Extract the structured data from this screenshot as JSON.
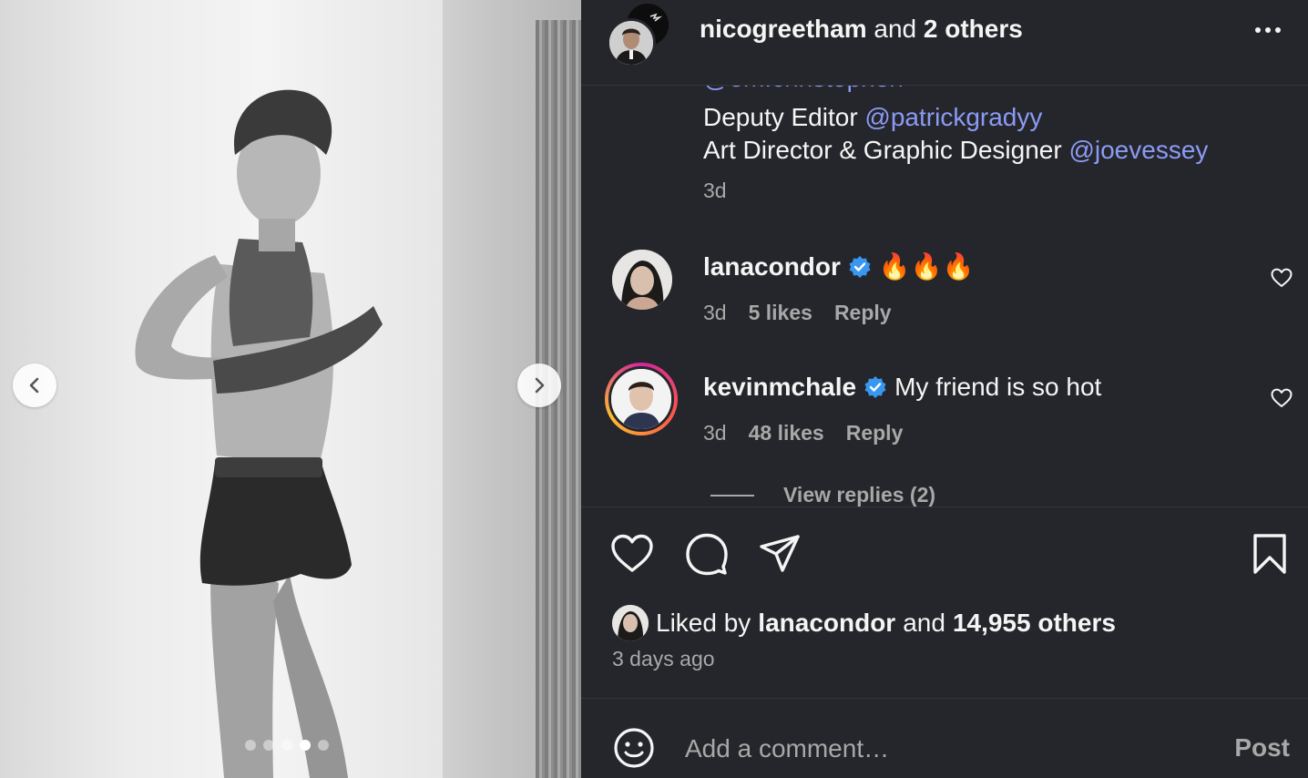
{
  "photo": {
    "carousel": {
      "total": 5,
      "active_index": 3
    },
    "icons": {
      "prev": "chevron-left-icon",
      "next": "chevron-right-icon"
    }
  },
  "header": {
    "username": "nicogreetham",
    "joiner": " and ",
    "others": "2 others",
    "more_icon": "more-horizontal-icon"
  },
  "caption": {
    "cut_text": "@em.christopherr",
    "lines": [
      {
        "prefix": "Deputy Editor ",
        "mention": "@patrickgradyy"
      },
      {
        "prefix": "Art Director & Graphic Designer ",
        "mention": "@joevessey"
      }
    ],
    "time": "3d"
  },
  "comments": [
    {
      "username": "lanacondor",
      "verified": true,
      "text": "🔥🔥🔥",
      "time": "3d",
      "likes": "5 likes",
      "reply": "Reply"
    },
    {
      "username": "kevinmchale",
      "verified": true,
      "text": "My friend is so hot",
      "time": "3d",
      "likes": "48 likes",
      "reply": "Reply",
      "view_replies": "View replies (2)"
    }
  ],
  "actions": {
    "like": "heart-icon",
    "comment": "comment-icon",
    "share": "paper-plane-icon",
    "save": "bookmark-icon"
  },
  "likes": {
    "prefix": "Liked by ",
    "user": "lanacondor",
    "joiner": " and ",
    "others": "14,955 others"
  },
  "post_date": "3 days ago",
  "comment_bar": {
    "placeholder": "Add a comment…",
    "post_label": "Post",
    "emoji_icon": "emoji-icon"
  },
  "colors": {
    "panel_bg": "#25262b",
    "mention": "#8b9bf4",
    "verified": "#3897f0",
    "muted": "#a8a8a8"
  }
}
